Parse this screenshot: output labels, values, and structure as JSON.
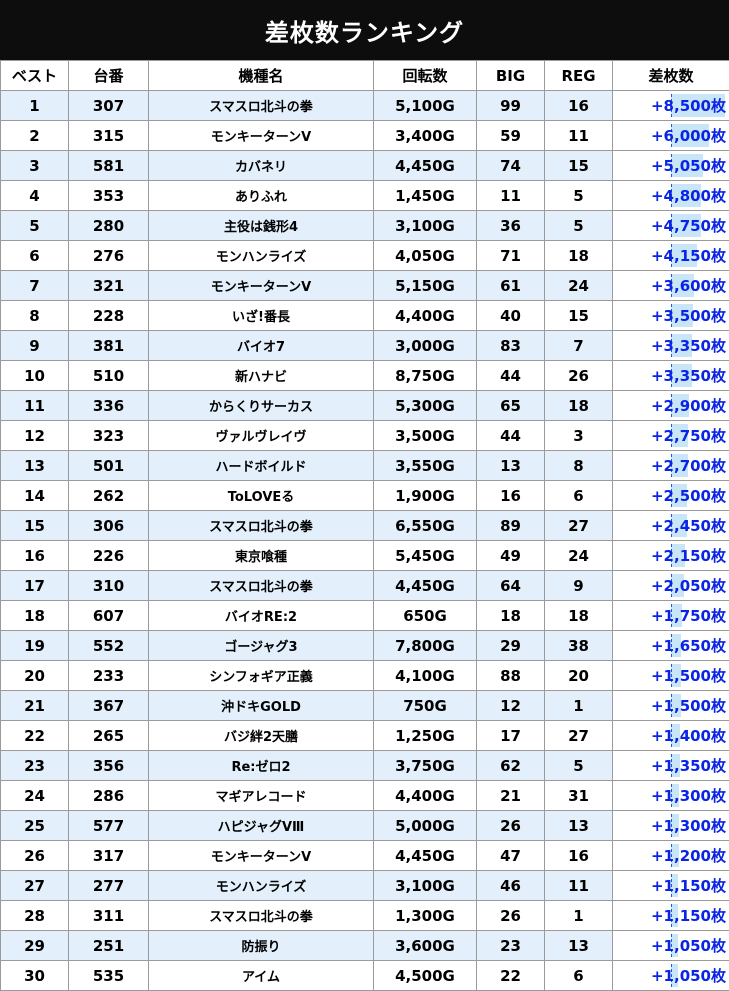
{
  "title": "差枚数ランキング",
  "headers": [
    "ベスト",
    "台番",
    "機種名",
    "回転数",
    "BIG",
    "REG",
    "差枚数"
  ],
  "bar_max": 8500,
  "colors": {
    "header_bg": "#0d0d0d",
    "row_alt": "#e3effb",
    "diff_text": "#0a24e6",
    "bar_fill": "#c9e6f9"
  },
  "rows": [
    {
      "rank": "1",
      "machine_no": "307",
      "model": "スマスロ北斗の拳",
      "spins": "5,100G",
      "big": "99",
      "reg": "16",
      "diff": "+8,500枚",
      "diff_value": 8500
    },
    {
      "rank": "2",
      "machine_no": "315",
      "model": "モンキーターンV",
      "spins": "3,400G",
      "big": "59",
      "reg": "11",
      "diff": "+6,000枚",
      "diff_value": 6000
    },
    {
      "rank": "3",
      "machine_no": "581",
      "model": "カバネリ",
      "spins": "4,450G",
      "big": "74",
      "reg": "15",
      "diff": "+5,050枚",
      "diff_value": 5050
    },
    {
      "rank": "4",
      "machine_no": "353",
      "model": "ありふれ",
      "spins": "1,450G",
      "big": "11",
      "reg": "5",
      "diff": "+4,800枚",
      "diff_value": 4800
    },
    {
      "rank": "5",
      "machine_no": "280",
      "model": "主役は銭形4",
      "spins": "3,100G",
      "big": "36",
      "reg": "5",
      "diff": "+4,750枚",
      "diff_value": 4750
    },
    {
      "rank": "6",
      "machine_no": "276",
      "model": "モンハンライズ",
      "spins": "4,050G",
      "big": "71",
      "reg": "18",
      "diff": "+4,150枚",
      "diff_value": 4150
    },
    {
      "rank": "7",
      "machine_no": "321",
      "model": "モンキーターンV",
      "spins": "5,150G",
      "big": "61",
      "reg": "24",
      "diff": "+3,600枚",
      "diff_value": 3600
    },
    {
      "rank": "8",
      "machine_no": "228",
      "model": "いざ!番長",
      "spins": "4,400G",
      "big": "40",
      "reg": "15",
      "diff": "+3,500枚",
      "diff_value": 3500
    },
    {
      "rank": "9",
      "machine_no": "381",
      "model": "バイオ7",
      "spins": "3,000G",
      "big": "83",
      "reg": "7",
      "diff": "+3,350枚",
      "diff_value": 3350
    },
    {
      "rank": "10",
      "machine_no": "510",
      "model": "新ハナビ",
      "spins": "8,750G",
      "big": "44",
      "reg": "26",
      "diff": "+3,350枚",
      "diff_value": 3350
    },
    {
      "rank": "11",
      "machine_no": "336",
      "model": "からくりサーカス",
      "spins": "5,300G",
      "big": "65",
      "reg": "18",
      "diff": "+2,900枚",
      "diff_value": 2900
    },
    {
      "rank": "12",
      "machine_no": "323",
      "model": "ヴァルヴレイヴ",
      "spins": "3,500G",
      "big": "44",
      "reg": "3",
      "diff": "+2,750枚",
      "diff_value": 2750
    },
    {
      "rank": "13",
      "machine_no": "501",
      "model": "ハードボイルド",
      "spins": "3,550G",
      "big": "13",
      "reg": "8",
      "diff": "+2,700枚",
      "diff_value": 2700
    },
    {
      "rank": "14",
      "machine_no": "262",
      "model": "ToLOVEる",
      "spins": "1,900G",
      "big": "16",
      "reg": "6",
      "diff": "+2,500枚",
      "diff_value": 2500
    },
    {
      "rank": "15",
      "machine_no": "306",
      "model": "スマスロ北斗の拳",
      "spins": "6,550G",
      "big": "89",
      "reg": "27",
      "diff": "+2,450枚",
      "diff_value": 2450
    },
    {
      "rank": "16",
      "machine_no": "226",
      "model": "東京喰種",
      "spins": "5,450G",
      "big": "49",
      "reg": "24",
      "diff": "+2,150枚",
      "diff_value": 2150
    },
    {
      "rank": "17",
      "machine_no": "310",
      "model": "スマスロ北斗の拳",
      "spins": "4,450G",
      "big": "64",
      "reg": "9",
      "diff": "+2,050枚",
      "diff_value": 2050
    },
    {
      "rank": "18",
      "machine_no": "607",
      "model": "バイオRE:2",
      "spins": "650G",
      "big": "18",
      "reg": "18",
      "diff": "+1,750枚",
      "diff_value": 1750
    },
    {
      "rank": "19",
      "machine_no": "552",
      "model": "ゴージャグ3",
      "spins": "7,800G",
      "big": "29",
      "reg": "38",
      "diff": "+1,650枚",
      "diff_value": 1650
    },
    {
      "rank": "20",
      "machine_no": "233",
      "model": "シンフォギア正義",
      "spins": "4,100G",
      "big": "88",
      "reg": "20",
      "diff": "+1,500枚",
      "diff_value": 1500
    },
    {
      "rank": "21",
      "machine_no": "367",
      "model": "沖ドキGOLD",
      "spins": "750G",
      "big": "12",
      "reg": "1",
      "diff": "+1,500枚",
      "diff_value": 1500
    },
    {
      "rank": "22",
      "machine_no": "265",
      "model": "バジ絆2天膳",
      "spins": "1,250G",
      "big": "17",
      "reg": "27",
      "diff": "+1,400枚",
      "diff_value": 1400
    },
    {
      "rank": "23",
      "machine_no": "356",
      "model": "Re:ゼロ2",
      "spins": "3,750G",
      "big": "62",
      "reg": "5",
      "diff": "+1,350枚",
      "diff_value": 1350
    },
    {
      "rank": "24",
      "machine_no": "286",
      "model": "マギアレコード",
      "spins": "4,400G",
      "big": "21",
      "reg": "31",
      "diff": "+1,300枚",
      "diff_value": 1300
    },
    {
      "rank": "25",
      "machine_no": "577",
      "model": "ハピジャグVⅢ",
      "spins": "5,000G",
      "big": "26",
      "reg": "13",
      "diff": "+1,300枚",
      "diff_value": 1300
    },
    {
      "rank": "26",
      "machine_no": "317",
      "model": "モンキーターンV",
      "spins": "4,450G",
      "big": "47",
      "reg": "16",
      "diff": "+1,200枚",
      "diff_value": 1200
    },
    {
      "rank": "27",
      "machine_no": "277",
      "model": "モンハンライズ",
      "spins": "3,100G",
      "big": "46",
      "reg": "11",
      "diff": "+1,150枚",
      "diff_value": 1150
    },
    {
      "rank": "28",
      "machine_no": "311",
      "model": "スマスロ北斗の拳",
      "spins": "1,300G",
      "big": "26",
      "reg": "1",
      "diff": "+1,150枚",
      "diff_value": 1150
    },
    {
      "rank": "29",
      "machine_no": "251",
      "model": "防振り",
      "spins": "3,600G",
      "big": "23",
      "reg": "13",
      "diff": "+1,050枚",
      "diff_value": 1050
    },
    {
      "rank": "30",
      "machine_no": "535",
      "model": "アイム",
      "spins": "4,500G",
      "big": "22",
      "reg": "6",
      "diff": "+1,050枚",
      "diff_value": 1050
    }
  ]
}
